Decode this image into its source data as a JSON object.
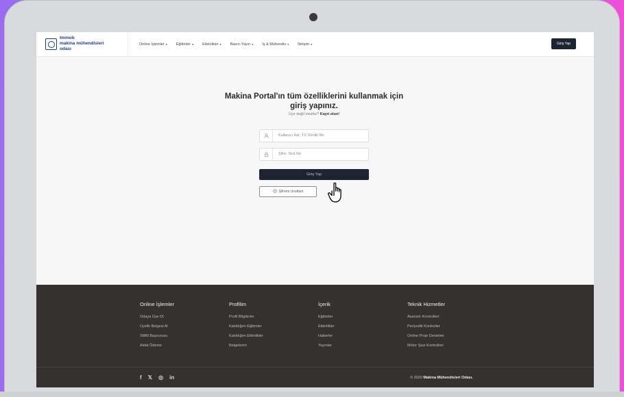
{
  "header": {
    "logo_line1": "tmmob",
    "logo_line2": "makina mühendisleri odası",
    "nav": [
      {
        "label": "Online İşlemler",
        "caret": "▾"
      },
      {
        "label": "Eğitimler",
        "caret": "▾"
      },
      {
        "label": "Etkinlikler",
        "caret": "▾"
      },
      {
        "label": "Basın-Yayın",
        "caret": "▾"
      },
      {
        "label": "İş & Mühendis",
        "caret": "▾"
      },
      {
        "label": "İletişim",
        "caret": "▾"
      }
    ],
    "login_button": "Giriş Yap"
  },
  "login": {
    "title_line1": "Makina Portal'ın tüm özelliklerini kullanmak için",
    "title_line2": "giriş yapınız.",
    "subtitle_text": "Üye değil misiniz?",
    "subtitle_link": "Kayıt olun!",
    "username_placeholder": "Kullanıcı Adı: T.C Kimlik No",
    "password_placeholder": "Şifre: Sicil No",
    "submit_label": "Giriş Yap",
    "forgot_label": "Şifremi Unuttum"
  },
  "footer": {
    "columns": [
      {
        "heading": "Online İşlemler",
        "links": [
          "Odaya Üye Ol",
          "Üyelik Belgesi Al",
          "SMM Başvurusu",
          "Aidat Ödeme"
        ]
      },
      {
        "heading": "Profilim",
        "links": [
          "Profil Bilgilerim",
          "Katıldığım Eğitimler",
          "Katıldığım Etkinlikler",
          "Belgelerim"
        ]
      },
      {
        "heading": "İçerik",
        "links": [
          "Eğitimler",
          "Etkinlikler",
          "Haberler",
          "Yayınlar"
        ]
      },
      {
        "heading": "Teknik Hizmetler",
        "links": [
          "Asansör Kontrolleri",
          "Periyodik Kontroller",
          "Online Proje Denetimi",
          "Motor Şasi Kontrolleri"
        ]
      }
    ],
    "social": [
      "f",
      "𝕏",
      "◎",
      "in"
    ],
    "copyright_prefix": "© 2020",
    "copyright_org": "Makina Mühendisleri Odası."
  },
  "colors": {
    "primary_dark": "#1f2433",
    "footer_bg": "#35312e",
    "brand_blue": "#1d3a8a"
  },
  "icons": {
    "username": "user-icon",
    "password": "lock-icon",
    "forgot": "key-icon",
    "cursor": "hand-pointer-icon"
  }
}
